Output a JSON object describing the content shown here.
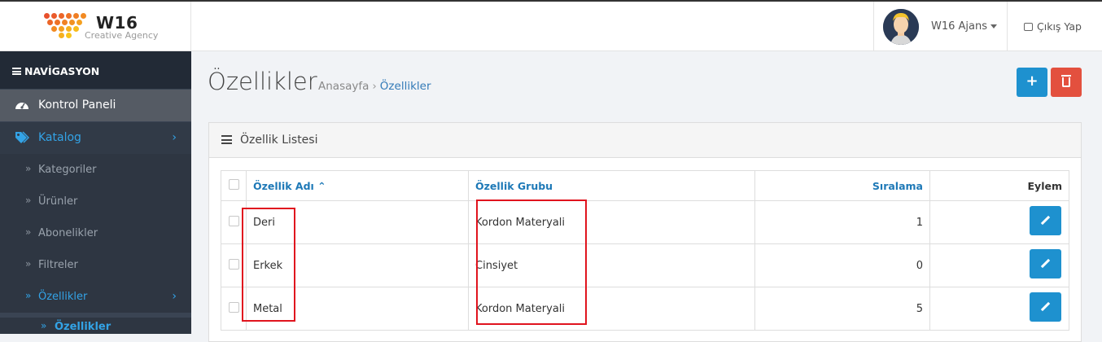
{
  "header": {
    "logo_title": "W16",
    "logo_subtitle": "Creative Agency",
    "user_name": "W16 Ajans",
    "logout_label": "Çıkış Yap"
  },
  "sidebar": {
    "heading": "NAVİGASYON",
    "items": [
      {
        "label": "Kontrol Paneli",
        "icon": "dashboard-icon"
      },
      {
        "label": "Katalog",
        "icon": "tags-icon"
      }
    ],
    "subitems": [
      {
        "label": "Kategoriler"
      },
      {
        "label": "Ürünler"
      },
      {
        "label": "Abonelikler"
      },
      {
        "label": "Filtreler"
      },
      {
        "label": "Özellikler"
      }
    ],
    "subsub_label": "Özellikler",
    "arrow": "›",
    "dbl_arrow": "»"
  },
  "page": {
    "title": "Özellikler",
    "breadcrumb_home": "Anasayfa",
    "breadcrumb_sep": "›",
    "breadcrumb_current": "Özellikler",
    "add_button_label": "+"
  },
  "panel": {
    "title": "Özellik Listesi"
  },
  "table": {
    "headers": {
      "name": "Özellik Adı",
      "group": "Özellik Grubu",
      "order": "Sıralama",
      "action": "Eylem"
    },
    "rows": [
      {
        "name": "Deri",
        "group": "Kordon Materyali",
        "order": "1"
      },
      {
        "name": "Erkek",
        "group": "Cinsiyet",
        "order": "0"
      },
      {
        "name": "Metal",
        "group": "Kordon Materyali",
        "order": "5"
      }
    ]
  },
  "colors": {
    "accent_blue": "#1e91cf",
    "danger_red": "#e3503e",
    "highlight_red": "#e0141e",
    "sidebar_bg": "#3a4453"
  }
}
